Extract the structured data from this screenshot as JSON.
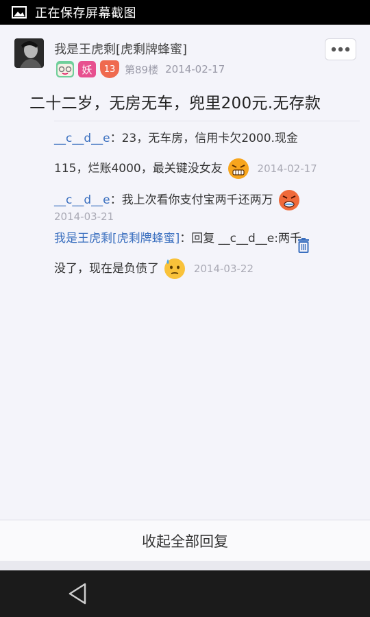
{
  "status_bar": {
    "text": "正在保存屏幕截图",
    "icon": "image-icon"
  },
  "post": {
    "username": "我是王虎剩[虎剩牌蜂蜜]",
    "level": "13",
    "badge_text": "妖",
    "floor": "第89楼",
    "date": "2014-02-17",
    "body": "二十二岁，无房无车，兜里200元.无存款",
    "more_icon": "more-dots-icon"
  },
  "replies": [
    {
      "name": "__c__d__e",
      "text_line1": "：23，无车房，信用卡欠2000.现金",
      "text_line2": "115，烂账4000，最关键没女友",
      "date": "2014-02-17"
    },
    {
      "name": "__c__d__e",
      "text": "：我上次看你支付宝两千还两万",
      "date": "2014-03-21"
    },
    {
      "name": "我是王虎剩[虎剩牌蜂蜜]",
      "prefix": "：回复 ",
      "reply_to": "__c__d__e",
      "text_line1": ":两千",
      "text_line2": "没了，现在是负债了",
      "date": "2014-03-22"
    }
  ],
  "collapse": {
    "label": "收起全部回复"
  },
  "nav": {
    "back_icon": "back-triangle-icon"
  }
}
